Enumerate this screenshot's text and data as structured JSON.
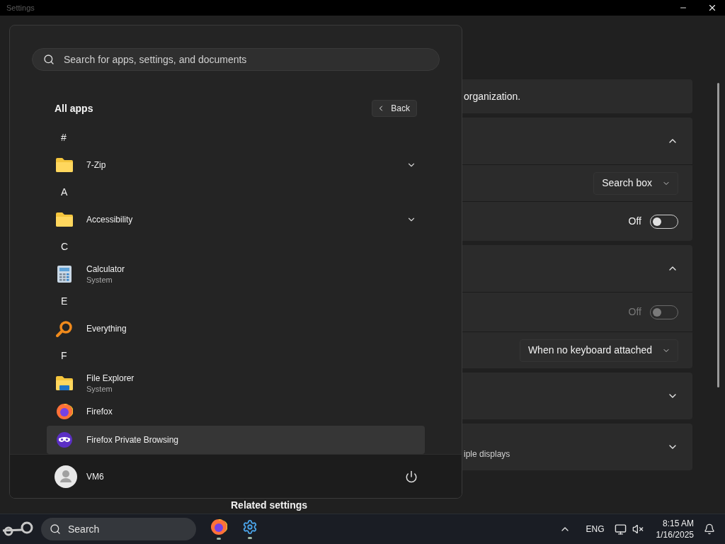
{
  "window": {
    "title": "Settings"
  },
  "settings": {
    "cards": [
      {
        "rows": [
          {
            "kind": "text",
            "text": "organization."
          }
        ]
      },
      {
        "rows": [
          {
            "kind": "expander",
            "expanded": true
          },
          {
            "kind": "dropdown",
            "value": "Search box"
          },
          {
            "kind": "toggle",
            "label": "Off",
            "on": false,
            "disabled": false
          }
        ]
      },
      {
        "rows": [
          {
            "kind": "expander",
            "expanded": true
          },
          {
            "kind": "toggle",
            "label": "Off",
            "on": false,
            "disabled": true
          },
          {
            "kind": "dropdown",
            "value": "When no keyboard attached"
          }
        ]
      },
      {
        "rows": [
          {
            "kind": "expander",
            "expanded": false
          }
        ]
      },
      {
        "rows": [
          {
            "kind": "expander",
            "expanded": false,
            "text": "iple displays"
          }
        ]
      }
    ],
    "related_heading": "Related settings"
  },
  "start_menu": {
    "search": {
      "placeholder": "Search for apps, settings, and documents"
    },
    "heading": "All apps",
    "back_button": "Back",
    "items": [
      {
        "kind": "letter",
        "label": "#"
      },
      {
        "kind": "folder",
        "label": "7-Zip",
        "hovered": false
      },
      {
        "kind": "letter",
        "label": "A"
      },
      {
        "kind": "folder",
        "label": "Accessibility",
        "hovered": false
      },
      {
        "kind": "letter",
        "label": "C"
      },
      {
        "kind": "app",
        "label": "Calculator",
        "subtitle": "System",
        "hovered": false
      },
      {
        "kind": "letter",
        "label": "E"
      },
      {
        "kind": "app",
        "label": "Everything",
        "hovered": false
      },
      {
        "kind": "letter",
        "label": "F"
      },
      {
        "kind": "app",
        "label": "File Explorer",
        "subtitle": "System",
        "hovered": false
      },
      {
        "kind": "app",
        "label": "Firefox",
        "hovered": false
      },
      {
        "kind": "app",
        "label": "Firefox Private Browsing",
        "hovered": true
      }
    ],
    "user": {
      "name": "VM6"
    }
  },
  "taskbar": {
    "search_label": "Search",
    "apps": [
      {
        "running": true
      },
      {
        "running": true
      }
    ],
    "language": "ENG",
    "time": "8:15 AM",
    "date": "1/16/2025"
  }
}
